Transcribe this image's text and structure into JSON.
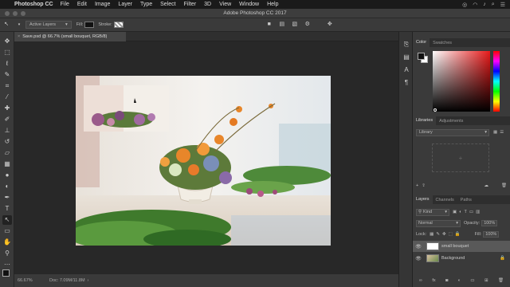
{
  "menubar": {
    "app_name": "Photoshop CC",
    "items": [
      "File",
      "Edit",
      "Image",
      "Layer",
      "Type",
      "Select",
      "Filter",
      "3D",
      "View",
      "Window",
      "Help"
    ]
  },
  "window": {
    "title": "Adobe Photoshop CC 2017"
  },
  "options": {
    "select_value": "Active Layers",
    "fill_label": "Fill:",
    "stroke_label": "Stroke:"
  },
  "document": {
    "tab_label": "Save.psd @ 66.7% (small bouquet, RGB/8)"
  },
  "status": {
    "zoom": "66.67%",
    "doc_info": "Doc: 7.09M/11.8M"
  },
  "panels": {
    "color_tabs": [
      "Color",
      "Swatches"
    ],
    "libraries_tabs": [
      "Libraries",
      "Adjustments"
    ],
    "library_select": "Library",
    "layers_tabs": [
      "Layers",
      "Channels",
      "Paths"
    ],
    "kind_label": "Kind",
    "blend_mode": "Normal",
    "opacity_label": "Opacity:",
    "opacity_value": "100%",
    "lock_label": "Lock:",
    "fill_label": "Fill:",
    "fill_value": "100%",
    "layers": [
      "small bouquet",
      "Background"
    ]
  },
  "colors": {
    "accent": "#e81a1a"
  }
}
